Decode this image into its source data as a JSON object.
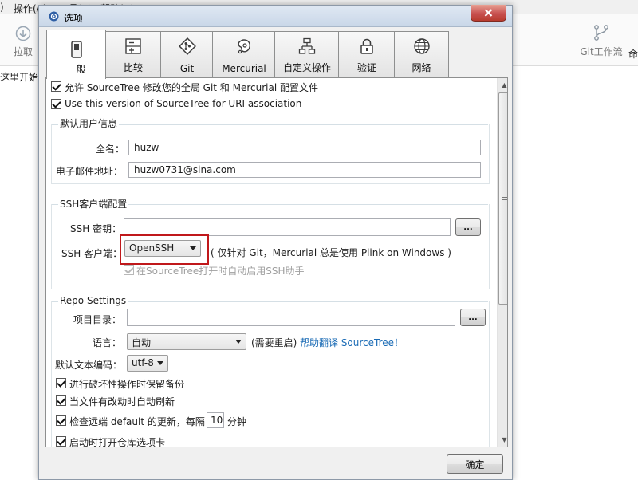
{
  "background": {
    "menu_left_fragment": ")",
    "menu_items": [
      "操作(A)",
      "工具(T)",
      "帮助(H)"
    ],
    "pull_label": "拉取",
    "gitflow_label": "Git工作流",
    "cmd_label_fragment": "命",
    "sidebar_text_fragment": "这里开始"
  },
  "dialog": {
    "title": "选项",
    "tabs": [
      {
        "label": "一般",
        "icon": "phone-icon"
      },
      {
        "label": "比较",
        "icon": "compare-icon"
      },
      {
        "label": "Git",
        "icon": "git-icon"
      },
      {
        "label": "Mercurial",
        "icon": "mercurial-icon"
      },
      {
        "label": "自定义操作",
        "icon": "custom-actions-icon"
      },
      {
        "label": "验证",
        "icon": "lock-icon"
      },
      {
        "label": "网络",
        "icon": "globe-icon"
      }
    ],
    "active_tab": "一般",
    "general": {
      "allow_modify_global": {
        "label": "允许 SourceTree 修改您的全局 Git 和 Mercurial 配置文件",
        "checked": true
      },
      "uri_association": {
        "label": "Use this version of SourceTree for URI association",
        "checked": true
      },
      "user_info": {
        "title": "默认用户信息",
        "fullname_label": "全名：",
        "fullname_value": "huzw",
        "email_label": "电子邮件地址：",
        "email_value": "huzw0731@sina.com"
      },
      "ssh": {
        "title": "SSH客户端配置",
        "key_label": "SSH 密钥：",
        "key_value": "",
        "browse_label": "...",
        "client_label": "SSH 客户端：",
        "client_value": "OpenSSH",
        "client_note": "( 仅针对 Git，Mercurial 总是使用 Plink on Windows )",
        "auto_agent": {
          "label": "在SourceTree打开时自动启用SSH助手",
          "checked": true,
          "disabled": true
        }
      },
      "repo": {
        "title": "Repo Settings",
        "project_dir_label": "项目目录：",
        "project_dir_value": "",
        "browse_label": "...",
        "language_label": "语言：",
        "language_value": "自动",
        "language_note": "(需要重启)",
        "translate_link": "帮助翻译 SourceTree！",
        "encoding_label": "默认文本编码：",
        "encoding_value": "utf-8",
        "keep_backup": {
          "label": "进行破坏性操作时保留备份",
          "checked": true
        },
        "auto_refresh": {
          "label": "当文件有改动时自动刷新",
          "checked": true
        },
        "check_remote": {
          "label_prefix": "检查远端 default 的更新，每隔",
          "interval": "10",
          "label_suffix": "分钟",
          "checked": true
        },
        "open_tabs": {
          "label": "启动时打开仓库选项卡",
          "checked": true
        }
      }
    },
    "ok_label": "确定"
  }
}
